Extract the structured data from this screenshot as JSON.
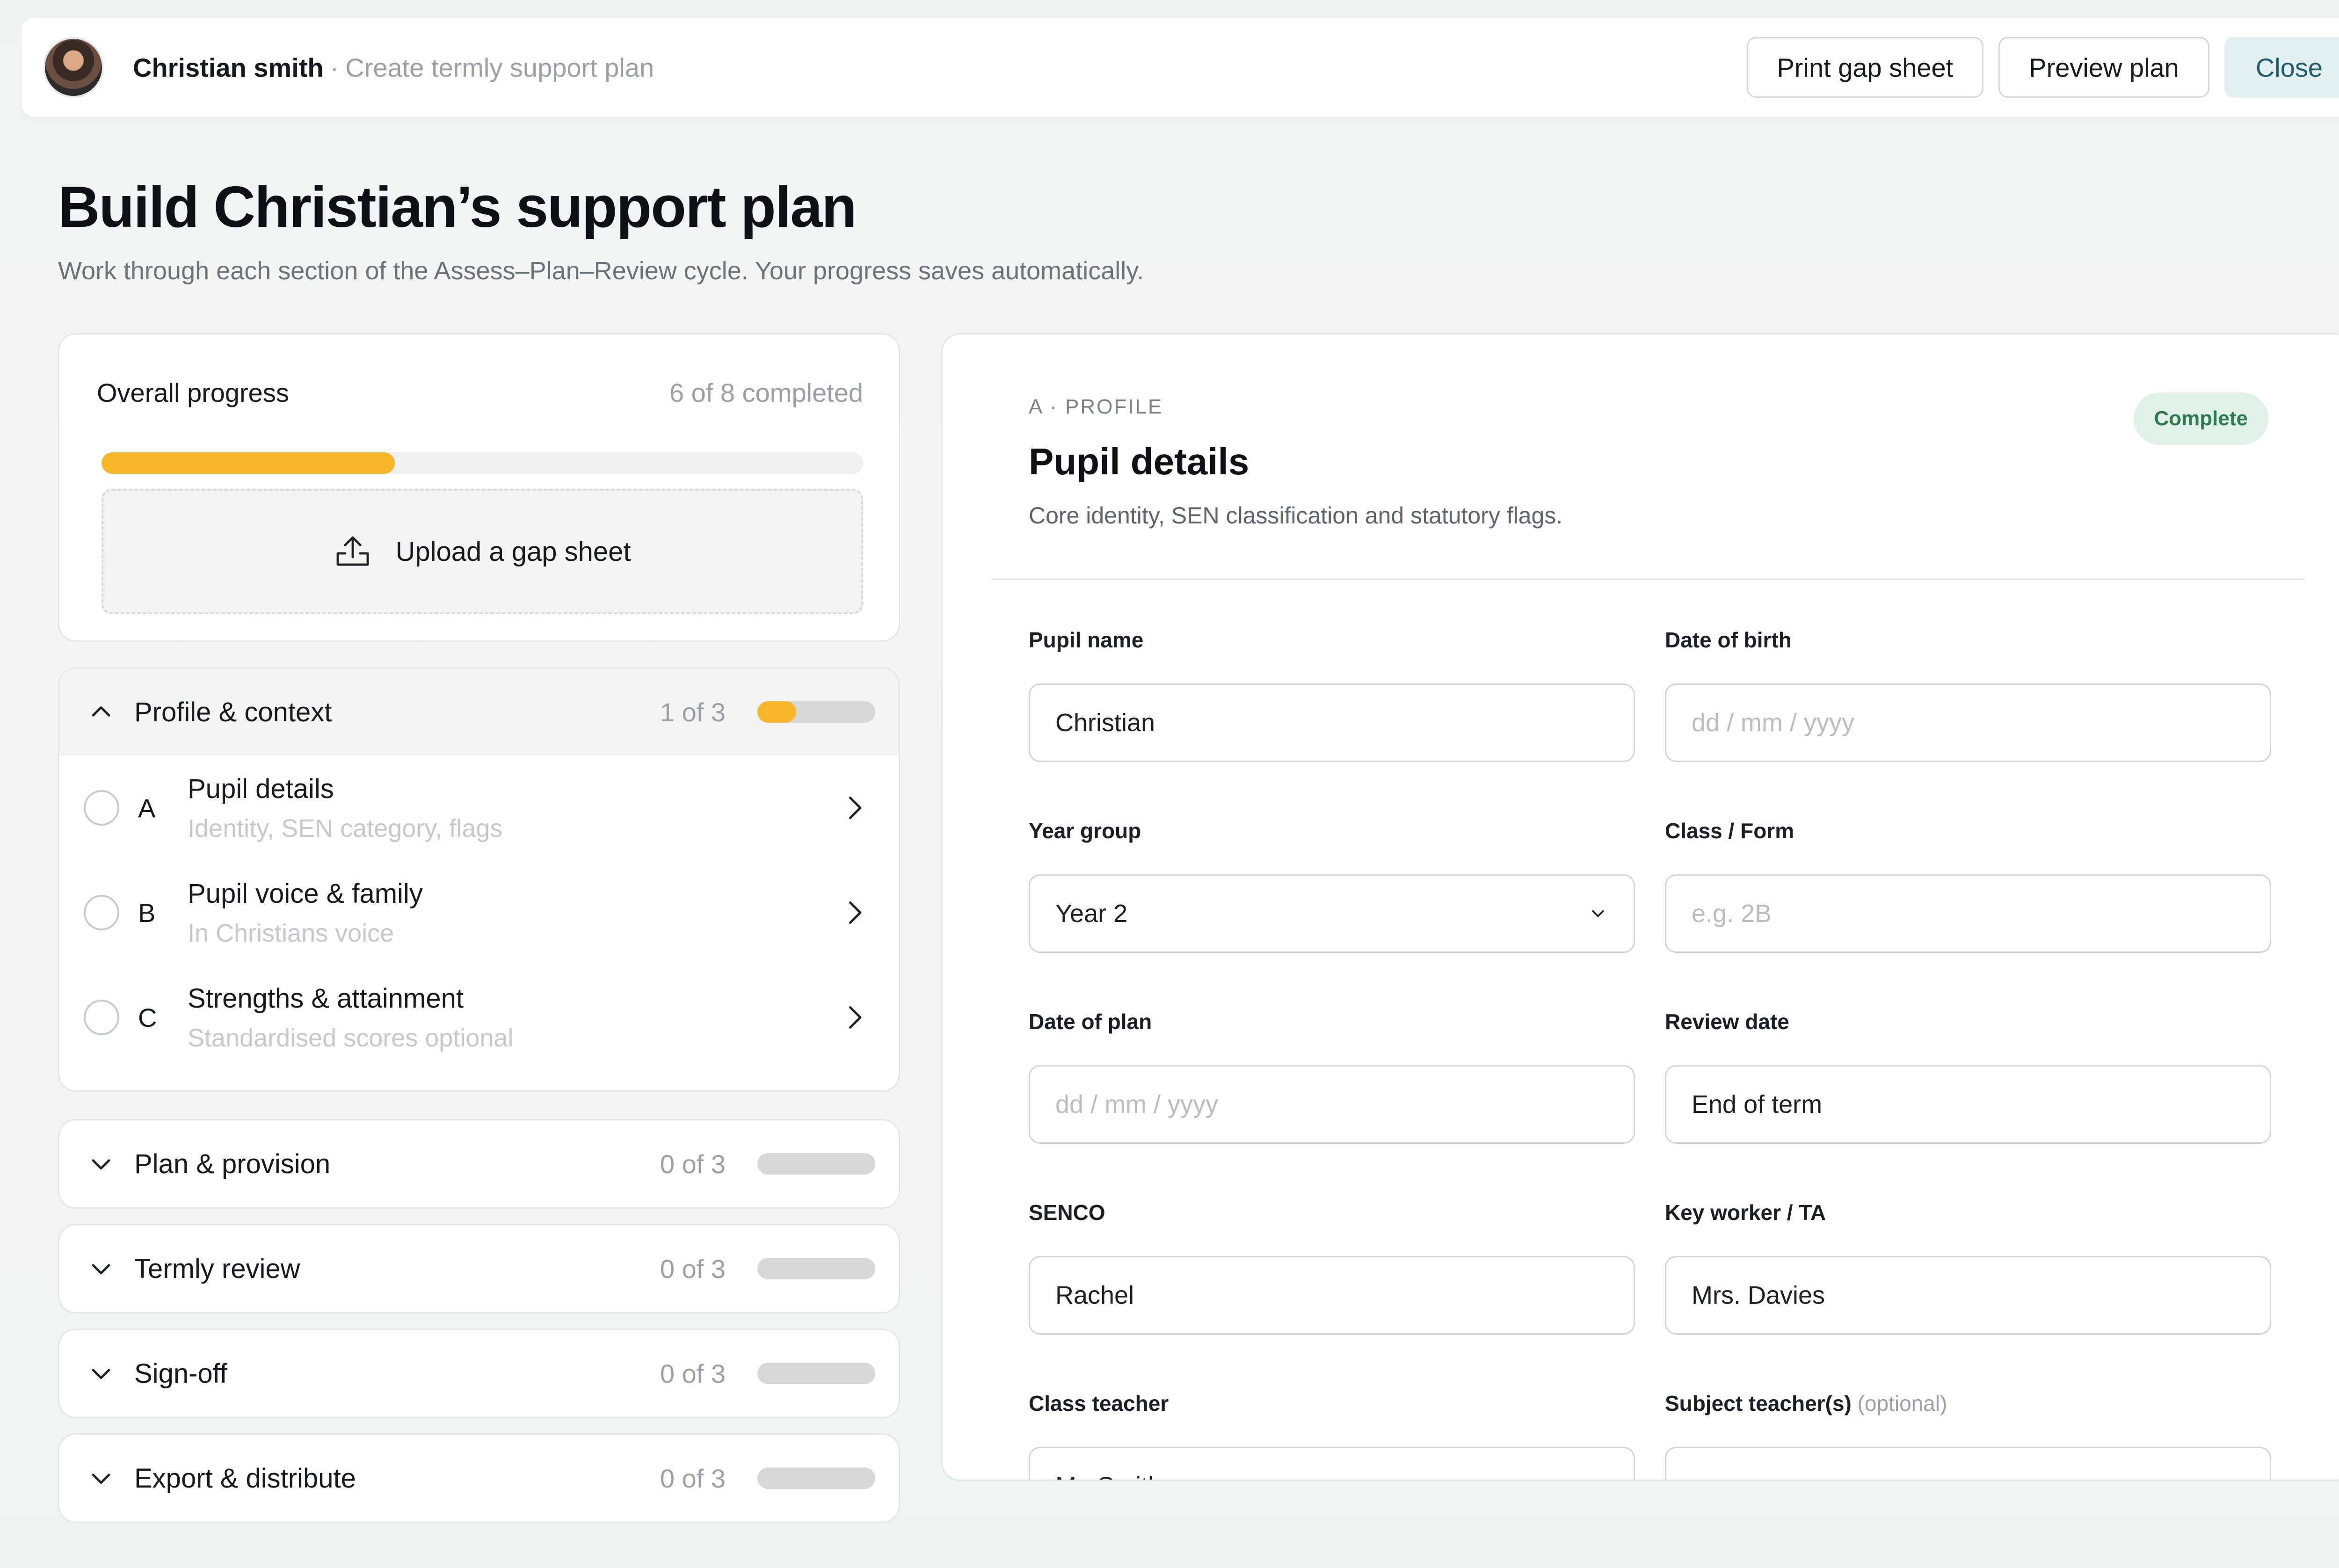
{
  "header": {
    "user_name": "Christian smith",
    "separator": "·",
    "subtitle": "Create termly support plan",
    "buttons": {
      "print": "Print gap sheet",
      "preview": "Preview plan",
      "close": "Close"
    }
  },
  "page": {
    "title": "Build Christian’s support plan",
    "subtitle": "Work through each section of the Assess–Plan–Review cycle. Your progress saves automatically."
  },
  "progress": {
    "label": "Overall progress",
    "count_text": "6 of 8 completed",
    "bar_fraction": 0.385,
    "upload_label": "Upload a gap sheet"
  },
  "sections": [
    {
      "title": "Profile & context",
      "count": "1 of 3",
      "fill": 0.33,
      "expanded": true,
      "items": [
        {
          "letter": "A",
          "title": "Pupil details",
          "subtitle": "Identity, SEN category, flags"
        },
        {
          "letter": "B",
          "title": "Pupil voice & family",
          "subtitle": "In Christians voice"
        },
        {
          "letter": "C",
          "title": "Strengths & attainment",
          "subtitle": "Standardised scores optional"
        }
      ]
    },
    {
      "title": "Plan & provision",
      "count": "0 of 3",
      "fill": 0
    },
    {
      "title": "Termly review",
      "count": "0 of 3",
      "fill": 0
    },
    {
      "title": "Sign-off",
      "count": "0 of 3",
      "fill": 0
    },
    {
      "title": "Export & distribute",
      "count": "0 of 3",
      "fill": 0
    }
  ],
  "form": {
    "eyebrow": "A · PROFILE",
    "status": "Complete",
    "title": "Pupil details",
    "description": "Core identity, SEN classification and statutory flags.",
    "fields": {
      "pupil_name": {
        "label": "Pupil name",
        "value": "Christian"
      },
      "dob": {
        "label": "Date of birth",
        "placeholder": "dd / mm / yyyy"
      },
      "year_group": {
        "label": "Year group",
        "value": "Year 2"
      },
      "class_form": {
        "label": "Class / Form",
        "placeholder": "e.g. 2B"
      },
      "date_of_plan": {
        "label": "Date of plan",
        "placeholder": "dd / mm / yyyy"
      },
      "review_date": {
        "label": "Review date",
        "value": "End of term"
      },
      "senco": {
        "label": "SENCO",
        "value": "Rachel"
      },
      "key_worker": {
        "label": "Key worker / TA",
        "value": "Mrs. Davies"
      },
      "class_teacher": {
        "label": "Class teacher",
        "value": "Mr. Smith"
      },
      "subject_teachers": {
        "label": "Subject teacher(s)",
        "optional": "(optional)",
        "placeholder": "—"
      }
    }
  },
  "colors": {
    "accent": "#f7b52a",
    "close_bg": "#e2eff1",
    "close_text": "#1f5d6b",
    "badge_bg": "#e0f1e7",
    "badge_text": "#2f7a52"
  }
}
